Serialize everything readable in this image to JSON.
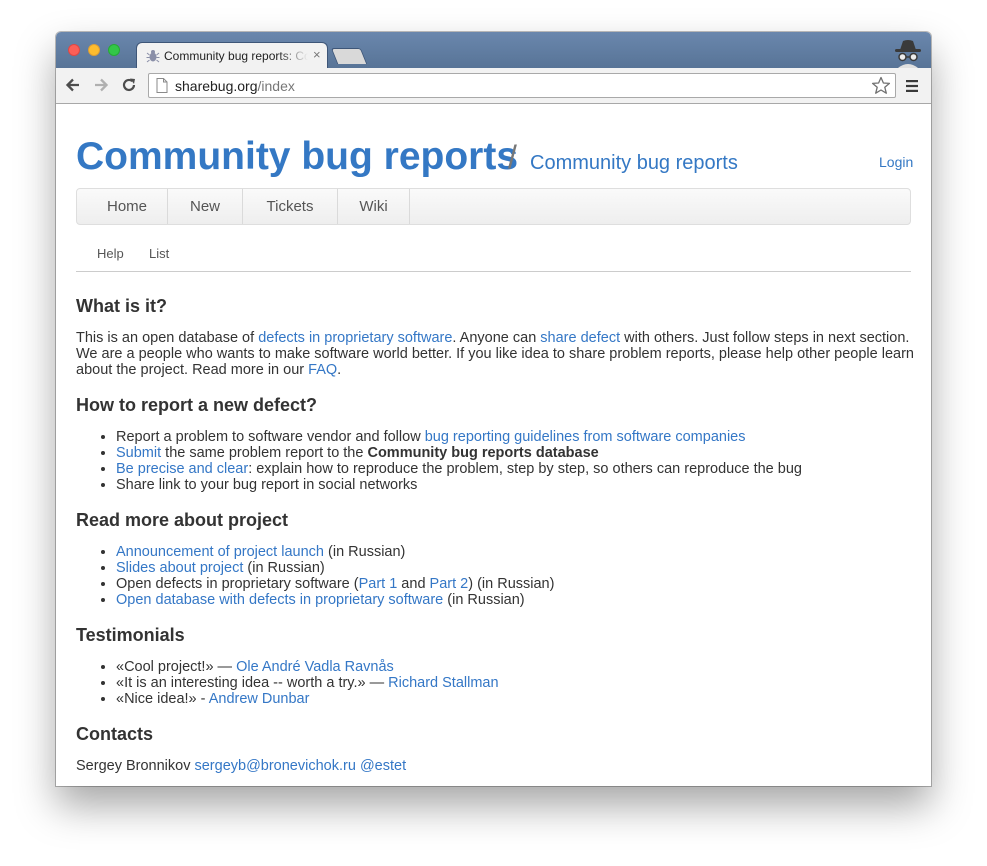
{
  "browser": {
    "tab_title": "Community bug reports: Community bug reports",
    "tab_close": "×",
    "url_host": "sharebug.org",
    "url_path": "/index"
  },
  "site": {
    "title": "Community bug reports",
    "separator": "/",
    "subtitle": "Community bug reports",
    "login": "Login"
  },
  "nav": {
    "items": [
      "Home",
      "New",
      "Tickets",
      "Wiki"
    ]
  },
  "subnav": {
    "items": [
      "Help",
      "List"
    ]
  },
  "what": {
    "heading": "What is it?",
    "t1": "This is an open database of ",
    "l1": "defects in proprietary software",
    "t2": ". Anyone can ",
    "l2": "share defect",
    "t3": " with others. Just follow steps in next section. We are a people who wants to make software world better. If you like idea to share problem reports, please help other people learn about the project. Read more in our ",
    "l3": "FAQ",
    "t4": "."
  },
  "howto": {
    "heading": "How to report a new defect?",
    "i1_text": "Report a problem to software vendor and follow ",
    "i1_link": "bug reporting guidelines from software companies",
    "i2_link": "Submit",
    "i2_text": " the same problem report to the ",
    "i2_bold": "Community bug reports database",
    "i3_link": "Be precise and clear",
    "i3_text": ": explain how to reproduce the problem, step by step, so others can reproduce the bug",
    "i4_text": "Share link to your bug report in social networks"
  },
  "readmore": {
    "heading": "Read more about project",
    "r1_link": "Announcement of project launch",
    "r1_text": " (in Russian)",
    "r2_link": "Slides about project",
    "r2_text": " (in Russian)",
    "r3_text": "Open defects in proprietary software (",
    "r3_link1": "Part 1",
    "r3_and": " and ",
    "r3_link2": "Part 2",
    "r3_end": ") (in Russian)",
    "r4_link": "Open database with defects in proprietary software",
    "r4_text": " (in Russian)"
  },
  "testimonials": {
    "heading": "Testimonials",
    "q1": "«Cool project!» — ",
    "a1": "Ole André Vadla Ravnås",
    "q2": "«It is an interesting idea -- worth a try.» — ",
    "a2": "Richard Stallman",
    "q3": "«Nice idea!» - ",
    "a3": "Andrew Dunbar"
  },
  "contacts": {
    "heading": "Contacts",
    "name": "Sergey Bronnikov ",
    "email": "sergeyb@bronevichok.ru",
    "twitter": "@estet"
  },
  "icons": {
    "favicon": "bug-icon",
    "incognito": "incognito-icon",
    "back": "back-arrow-icon",
    "forward": "forward-arrow-icon",
    "reload": "reload-icon",
    "page": "page-icon",
    "bookmark": "star-icon",
    "menu": "hamburger-menu-icon"
  },
  "colors": {
    "link": "#3477c6",
    "titlebar": "#6a87ad",
    "text": "#333333"
  }
}
